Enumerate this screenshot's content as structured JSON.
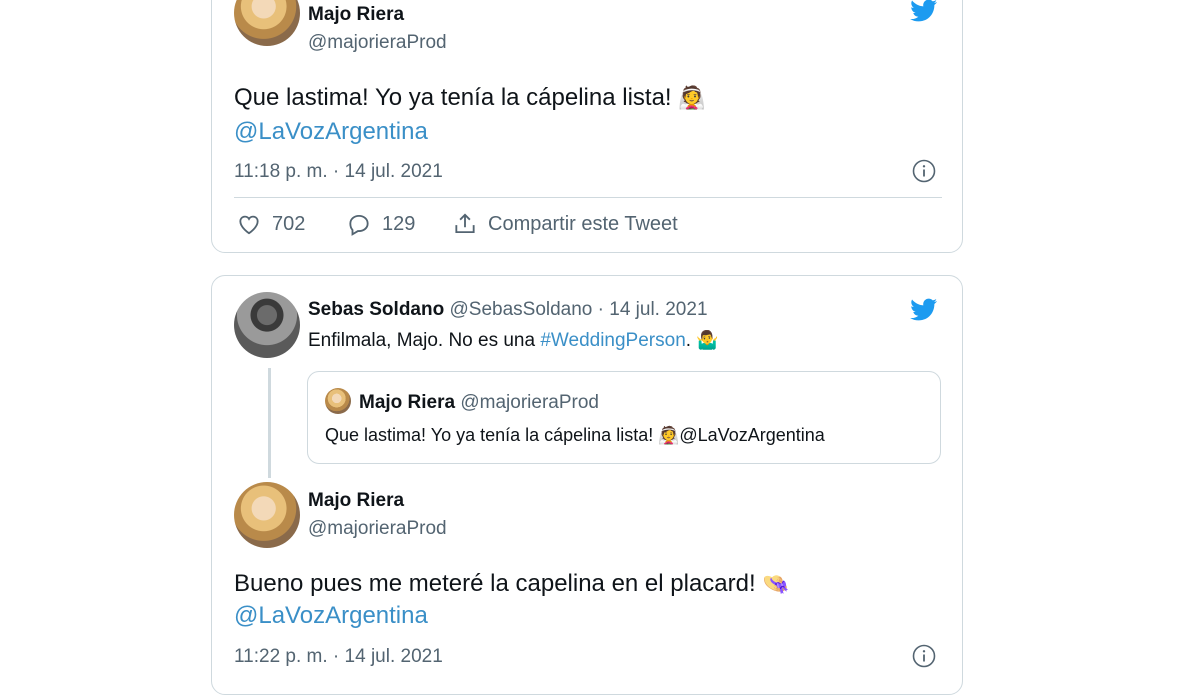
{
  "tweet1": {
    "name": "Majo Riera",
    "handle": "@majorieraProd",
    "text": "Que lastima! Yo ya tenía la cápelina lista!",
    "emoji": "👰",
    "mention": "@LaVozArgentina",
    "timestamp": "11:18 p. m. · 14 jul. 2021",
    "likes": "702",
    "replies": "129",
    "share_label": "Compartir este Tweet"
  },
  "tweet2": {
    "name": "Sebas Soldano",
    "handle_date": "@SebasSoldano · 14 jul. 2021",
    "text_prefix": "Enfilmala, Majo. No es una",
    "hashtag": "#WeddingPerson",
    "text_suffix": ".",
    "emoji": "🤷‍♂️",
    "quote": {
      "name": "Majo Riera",
      "handle": "@majorieraProd",
      "text": "Que lastima! Yo ya tenía la cápelina lista!",
      "emoji": "👰",
      "mention": "@LaVozArgentina"
    },
    "reply": {
      "name": "Majo Riera",
      "handle": "@majorieraProd",
      "text": "Bueno pues me meteré la capelina en el placard!",
      "emoji": "👒",
      "mention": "@LaVozArgentina",
      "timestamp": "11:22 p. m. · 14 jul. 2021"
    }
  },
  "colors": {
    "twitter_blue": "#1d9bf0",
    "link": "#3a8fc7",
    "muted": "#536471",
    "border": "#cfd9de"
  },
  "icons": [
    "twitter-bird-icon",
    "info-icon",
    "heart-icon",
    "reply-icon",
    "share-icon"
  ]
}
